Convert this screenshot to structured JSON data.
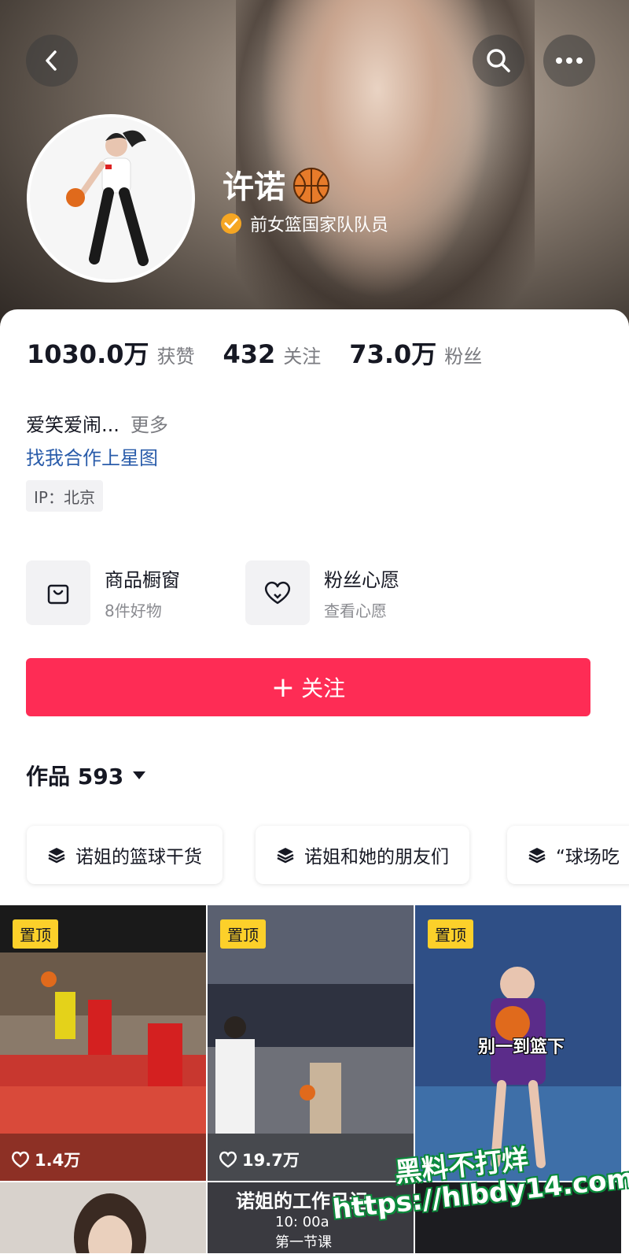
{
  "header": {
    "back_icon": "chevron-left-icon",
    "search_icon": "search-icon",
    "more_icon": "more-dots-icon"
  },
  "profile": {
    "name": "许诺",
    "name_emoji": "basketball-icon",
    "verified_text": "前女篮国家队队员",
    "stats": [
      {
        "value": "1030.0万",
        "label": "获赞"
      },
      {
        "value": "432",
        "label": "关注"
      },
      {
        "value": "73.0万",
        "label": "粉丝"
      }
    ],
    "bio": "爱笑爱闹...",
    "bio_more": "更多",
    "link_text": "找我合作上星图",
    "ip_label": "IP：北京"
  },
  "shortcuts": [
    {
      "title": "商品橱窗",
      "subtitle": "8件好物",
      "icon": "shopping-bag-icon"
    },
    {
      "title": "粉丝心愿",
      "subtitle": "查看心愿",
      "icon": "heart-wish-icon"
    }
  ],
  "follow_button": {
    "plus": "+",
    "label": "关注"
  },
  "works": {
    "label": "作品 593"
  },
  "collections": [
    {
      "label": "诺姐的篮球干货"
    },
    {
      "label": "诺姐和她的朋友们"
    },
    {
      "label": "“球场吃"
    }
  ],
  "videos": [
    {
      "pinned": "置顶",
      "likes": "1.4万"
    },
    {
      "pinned": "置顶",
      "likes": "19.7万"
    },
    {
      "pinned": "置顶",
      "caption": "别一到篮下"
    }
  ],
  "second_row": {
    "caption": "诺姐的工作日记",
    "sub1": "10: 00a",
    "sub2": "第一节课"
  },
  "watermark": {
    "line1": "黑料不打烊",
    "line2": "https://hlbdy14.com"
  },
  "colors": {
    "accent": "#fe2c55",
    "link": "#2a5caa",
    "pin": "#fcd02a",
    "verified": "#f5a623"
  }
}
